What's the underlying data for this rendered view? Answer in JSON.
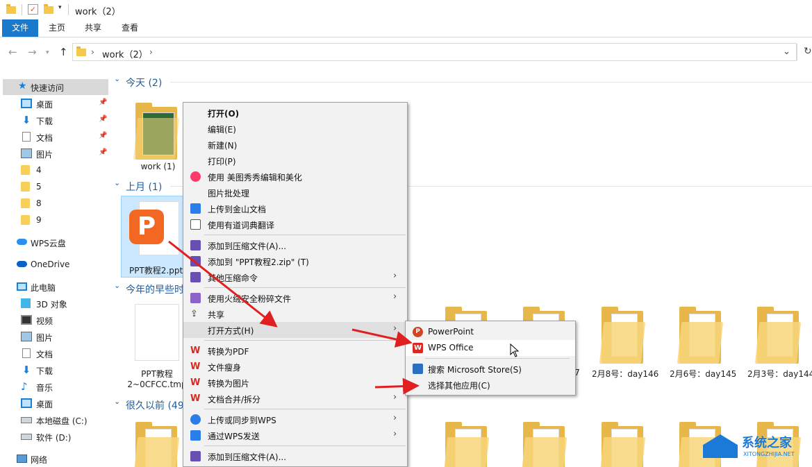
{
  "window": {
    "title": "work（2）"
  },
  "ribbon": {
    "tabs": [
      "文件",
      "主页",
      "共享",
      "查看"
    ]
  },
  "address": {
    "path": "work（2）",
    "sep": "›"
  },
  "sidebar": {
    "quick_access": "快速访问",
    "items": [
      {
        "label": "桌面",
        "icon": "desktop-icon",
        "pinned": true
      },
      {
        "label": "下载",
        "icon": "download-icon",
        "pinned": true
      },
      {
        "label": "文档",
        "icon": "document-icon",
        "pinned": true
      },
      {
        "label": "图片",
        "icon": "picture-icon",
        "pinned": true
      },
      {
        "label": "4",
        "icon": "folder-icon"
      },
      {
        "label": "5",
        "icon": "folder-icon"
      },
      {
        "label": "8",
        "icon": "folder-icon"
      },
      {
        "label": "9",
        "icon": "folder-icon"
      }
    ],
    "wps_cloud": "WPS云盘",
    "onedrive": "OneDrive",
    "this_pc": "此电脑",
    "pc_items": [
      {
        "label": "3D 对象",
        "icon": "3d-objects-icon"
      },
      {
        "label": "视频",
        "icon": "video-icon"
      },
      {
        "label": "图片",
        "icon": "picture-icon"
      },
      {
        "label": "文档",
        "icon": "document-icon"
      },
      {
        "label": "下载",
        "icon": "download-icon"
      },
      {
        "label": "音乐",
        "icon": "music-icon"
      },
      {
        "label": "桌面",
        "icon": "desktop-icon"
      },
      {
        "label": "本地磁盘 (C:)",
        "icon": "drive-icon"
      },
      {
        "label": "软件 (D:)",
        "icon": "drive-icon"
      }
    ],
    "network": "网络"
  },
  "content": {
    "groups": {
      "today": "今天 (2)",
      "last_month": "上月 (1)",
      "earlier_this_year": "今年的早些时",
      "long_ago": "很久以前 (49"
    },
    "files": {
      "work1": "work (1)",
      "ppt": "PPT教程2.pptx",
      "tmp_line1": "PPT教程",
      "tmp_line2": "2~0CFCC.tmp",
      "folder_a": "7",
      "folder_b": "2月8号：day146",
      "folder_c": "2月6号：day145",
      "folder_d": "2月3号：day144"
    }
  },
  "context_menu": {
    "items": [
      {
        "label": "打开(O)",
        "bold": true
      },
      {
        "label": "编辑(E)"
      },
      {
        "label": "新建(N)"
      },
      {
        "label": "打印(P)"
      },
      {
        "label": "使用 美图秀秀编辑和美化",
        "icon": "meitu-icon"
      },
      {
        "label": "图片批处理"
      },
      {
        "label": "上传到金山文档",
        "icon": "kdocs-icon"
      },
      {
        "label": "使用有道词典翻译",
        "icon": "youdao-icon"
      },
      {
        "label": "添加到压缩文件(A)...",
        "icon": "archive-icon"
      },
      {
        "label": "添加到 \"PPT教程2.zip\" (T)",
        "icon": "archive-icon"
      },
      {
        "label": "其他压缩命令",
        "icon": "archive-icon",
        "submenu": true
      },
      {
        "label": "使用火绒安全粉碎文件",
        "icon": "huorong-icon",
        "submenu": true
      },
      {
        "label": "共享",
        "icon": "share-icon"
      },
      {
        "label": "打开方式(H)",
        "submenu": true,
        "highlighted": true
      },
      {
        "label": "转换为PDF",
        "icon": "wps-icon"
      },
      {
        "label": "文件瘦身",
        "icon": "wps-icon"
      },
      {
        "label": "转换为图片",
        "icon": "wps-icon"
      },
      {
        "label": "文档合并/拆分",
        "icon": "wps-icon",
        "submenu": true
      },
      {
        "label": "上传或同步到WPS",
        "icon": "wps-cloud-icon",
        "submenu": true
      },
      {
        "label": "通过WPS发送",
        "icon": "wps-send-icon",
        "submenu": true
      },
      {
        "label": "添加到压缩文件(A)...",
        "icon": "archive-icon"
      }
    ]
  },
  "open_with_menu": {
    "items": [
      {
        "label": "PowerPoint",
        "icon": "powerpoint-icon"
      },
      {
        "label": "WPS Office",
        "icon": "wps-office-icon",
        "highlighted": true
      },
      {
        "label": "搜索 Microsoft Store(S)",
        "icon": "store-icon"
      },
      {
        "label": "选择其他应用(C)"
      }
    ]
  },
  "watermark": {
    "brand": "系统之家",
    "url": "XITONGZHIJIA.NET"
  },
  "colors": {
    "accent": "#1979ca",
    "group": "#1e5d9e",
    "arrow": "#e02020",
    "folder": "#f7cf5b",
    "wps_red": "#d82a20",
    "ppt_orange": "#f26722"
  }
}
